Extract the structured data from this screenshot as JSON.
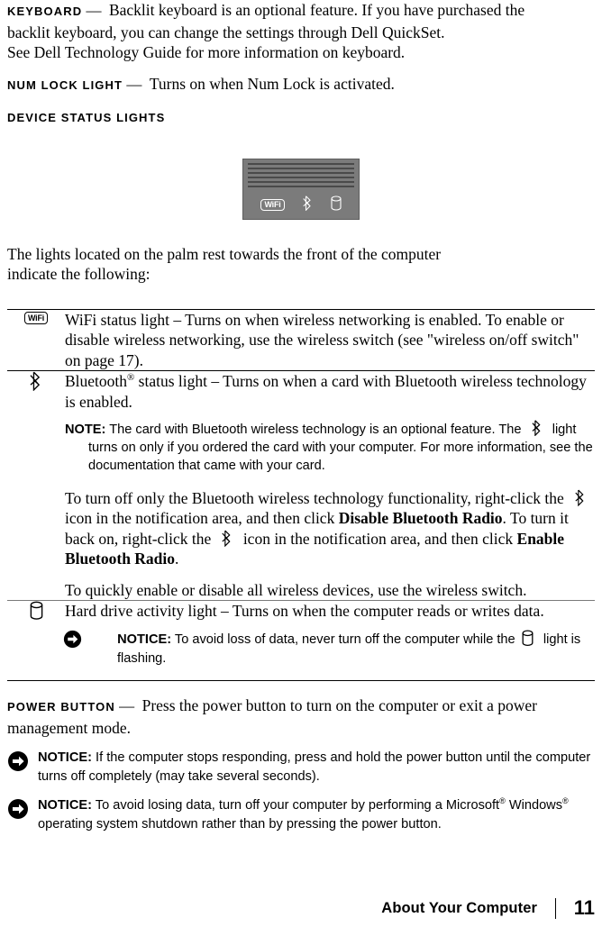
{
  "page": {
    "chapter": "About Your Computer",
    "number": "11"
  },
  "entries": {
    "keyboard": {
      "term": "KEYBOARD",
      "dash": "—",
      "line1": "Backlit keyboard is an optional feature. If you have purchased the",
      "line2": "backlit keyboard, you can change the settings through Dell QuickSet.",
      "line3": "See Dell Technology Guide for more information on keyboard."
    },
    "num_lock": {
      "term": "NUM LOCK LIGHT",
      "dash": "—",
      "text": "Turns on when Num Lock is activated."
    },
    "device_status": {
      "term": "DEVICE STATUS LIGHTS"
    },
    "power_button": {
      "term": "POWER BUTTON",
      "dash": "—",
      "line1": "Press the power button to turn on the computer or exit a power",
      "line2": "management mode."
    }
  },
  "illustration": {
    "name": "device-status-lights-panel",
    "icons": [
      "wifi-icon",
      "bluetooth-icon",
      "hard-drive-icon"
    ],
    "wifi_label": "WiFi",
    "background_color": "#7b7b7b",
    "grille_dot_color": "#4a4a4a"
  },
  "intro": {
    "line1": "The lights located on the palm rest towards the front of the computer",
    "line2": "indicate the following:"
  },
  "table": {
    "rows": [
      {
        "icon": "wifi-icon",
        "icon_label": "WiFi",
        "paragraphs": [
          {
            "style": "serif",
            "text": "WiFi status light – Turns on when wireless networking is enabled. To enable or disable wireless networking, use the wireless switch (see \"wireless on/off switch\" on page 17)."
          }
        ]
      },
      {
        "icon": "bluetooth-icon",
        "paragraphs": [
          {
            "style": "serif",
            "pre": "Bluetooth",
            "sup": "®",
            "post": " status light – Turns on when a card with Bluetooth wireless technology is enabled."
          },
          {
            "style": "note",
            "label": "NOTE:",
            "text_a": " The card with Bluetooth wireless technology is an optional feature. The",
            "text_b": " light turns on only if you ordered the card with your computer. For more information, see the documentation that came with your card."
          },
          {
            "style": "serif-inline-icons",
            "seg1": "To turn off only the Bluetooth wireless technology functionality, right-click the",
            "seg2": " icon in the notification area, and then click ",
            "bold1": "Disable Bluetooth Radio",
            "seg3": ". To turn it back on, right-click the ",
            "seg4": " icon in the notification area, and then click ",
            "bold2": "Enable Bluetooth Radio",
            "seg5": "."
          },
          {
            "style": "serif",
            "text": "To quickly enable or disable all wireless devices, use the wireless switch."
          }
        ]
      },
      {
        "icon": "hard-drive-icon",
        "paragraphs": [
          {
            "style": "serif",
            "text": "Hard drive activity light – Turns on when the computer reads or writes data."
          },
          {
            "style": "notice",
            "icon": "notice-arrow-icon",
            "label": "NOTICE:",
            "text_a": " To avoid loss of data, never turn off the computer while the",
            "text_b": " light is flashing."
          }
        ]
      }
    ]
  },
  "notices": [
    {
      "icon": "notice-arrow-icon",
      "label": "NOTICE:",
      "text": " If the computer stops responding, press and hold the power button until the computer turns off completely (may take several seconds)."
    },
    {
      "icon": "notice-arrow-icon",
      "label": "NOTICE:",
      "seg1": " To avoid losing data, turn off your computer by performing a Microsoft",
      "sup1": "®",
      "seg2": " Windows",
      "sup2": "®",
      "seg3": " operating system shutdown rather than by pressing the power button."
    }
  ]
}
